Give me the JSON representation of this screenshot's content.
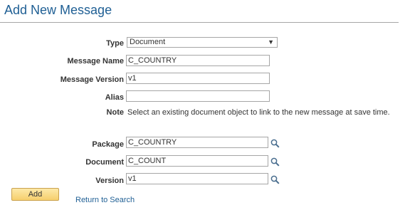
{
  "page": {
    "title": "Add New Message"
  },
  "form": {
    "type": {
      "label": "Type",
      "value": "Document"
    },
    "message_name": {
      "label": "Message Name",
      "value": "C_COUNTRY"
    },
    "message_version": {
      "label": "Message Version",
      "value": "v1"
    },
    "alias": {
      "label": "Alias",
      "value": ""
    },
    "note": {
      "label": "Note",
      "text": "Select an existing document object to link to the new message at save time."
    },
    "package": {
      "label": "Package",
      "value": "C_COUNTRY"
    },
    "document": {
      "label": "Document",
      "value": "C_COUNT"
    },
    "version": {
      "label": "Version",
      "value": "v1"
    }
  },
  "actions": {
    "add_label": "Add",
    "return_label": "Return to Search"
  },
  "icons": {
    "dropdown": "chevron-down-icon",
    "lookup": "search-icon"
  },
  "colors": {
    "title": "#1f5f94",
    "link": "#1f5f94",
    "button_top": "#fde9a8",
    "button_bottom": "#f6cf6d"
  }
}
